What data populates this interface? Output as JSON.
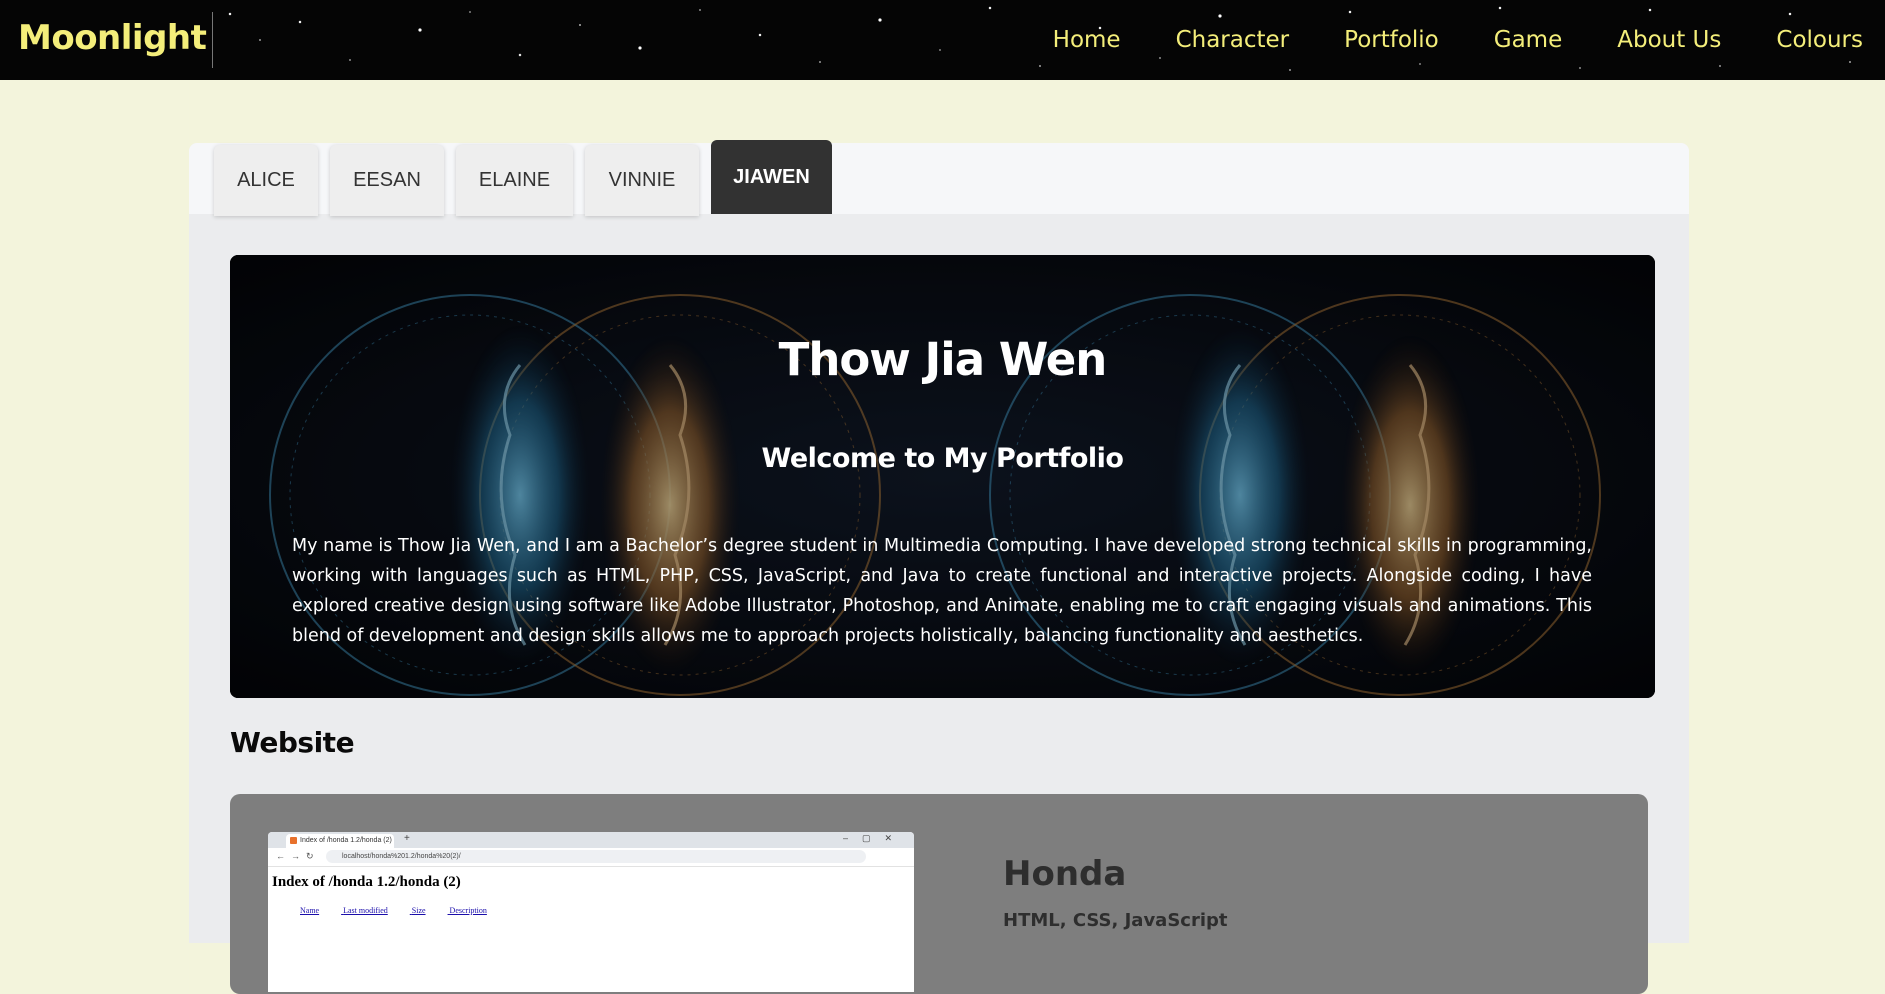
{
  "brand": "Moonlight",
  "nav": {
    "items": [
      "Home",
      "Character",
      "Portfolio",
      "Game",
      "About Us",
      "Colours"
    ]
  },
  "tabs": {
    "items": [
      "ALICE",
      "EESAN",
      "ELAINE",
      "VINNIE",
      "JIAWEN"
    ],
    "active": "JIAWEN"
  },
  "hero": {
    "title": "Thow Jia Wen",
    "subtitle": "Welcome to My Portfolio",
    "body": "My name is Thow Jia Wen, and I am a Bachelor’s degree student in Multimedia Computing. I have developed strong technical skills in programming, working with languages such as HTML, PHP, CSS, JavaScript, and Java to create functional and interactive projects. Alongside coding, I have explored creative design using software like Adobe Illustrator, Photoshop, and Animate, enabling me to craft engaging visuals and animations. This blend of development and design skills allows me to approach projects holistically, balancing functionality and aesthetics."
  },
  "section": {
    "heading": "Website"
  },
  "project": {
    "title": "Honda",
    "tech": "HTML, CSS, JavaScript",
    "screenshot": {
      "tab_title": "Index of /honda 1.2/honda (2)",
      "url": "localhost/honda%201.2/honda%20(2)/",
      "heading": "Index of /honda 1.2/honda (2)",
      "columns": [
        "Name",
        "Last modified",
        "Size",
        "Description"
      ]
    }
  },
  "colors": {
    "nav_bg": "#050505",
    "accent_yellow": "#f4ee7a",
    "page_bg": "#f3f4dc",
    "panel_bg": "#ebecee",
    "active_tab_bg": "#323232",
    "card_bg": "#7e7e7e"
  }
}
